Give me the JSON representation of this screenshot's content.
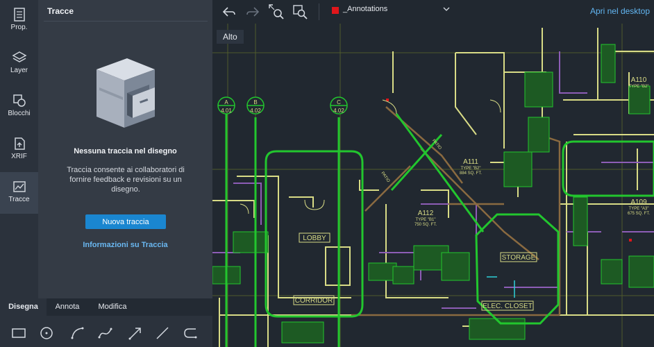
{
  "sidebar": {
    "items": [
      {
        "label": "Prop.",
        "icon": "properties-icon"
      },
      {
        "label": "Layer",
        "icon": "layers-icon"
      },
      {
        "label": "Blocchi",
        "icon": "blocks-icon"
      },
      {
        "label": "XRIF",
        "icon": "xref-icon"
      },
      {
        "label": "Tracce",
        "icon": "traces-icon",
        "active": true
      }
    ]
  },
  "panel": {
    "title": "Tracce",
    "empty_title": "Nessuna traccia nel disegno",
    "empty_description": "Traccia consente ai collaboratori di fornire feedback e revisioni su un disegno.",
    "new_button": "Nuova traccia",
    "info_link": "Informazioni su Traccia",
    "illustration_icon": "file-cabinet-icon"
  },
  "bottom": {
    "tabs": [
      {
        "label": "Disegna",
        "active": true
      },
      {
        "label": "Annota"
      },
      {
        "label": "Modifica"
      }
    ],
    "tools": [
      "rectangle-icon",
      "circle-icon",
      "arc-icon",
      "spline-icon",
      "arrow-line-icon",
      "line-icon",
      "polyline-icon"
    ]
  },
  "toolbar": {
    "icons": [
      "undo-icon",
      "redo-icon",
      "zoom-extents-icon",
      "zoom-window-icon"
    ],
    "layer": {
      "name": "_Annotations",
      "color": "#e0161b"
    },
    "desktop_link": "Apri nel desktop"
  },
  "canvas": {
    "view_label": "Alto",
    "room_labels": [
      "LOBBY",
      "CORRIDOR",
      "STORAGE",
      "ELEC. CLOSET",
      "A111",
      "A112",
      "A110",
      "A109",
      "PATIO",
      "PATIO"
    ],
    "grid_markers": [
      "A",
      "4.01",
      "B",
      "4.02",
      "C",
      "4.02"
    ],
    "colors": {
      "wall": "#d9dc86",
      "accent_green": "#22c62e",
      "purple": "#8d5db6",
      "brown": "#8a6a40",
      "cyan": "#2fd0d8"
    }
  }
}
